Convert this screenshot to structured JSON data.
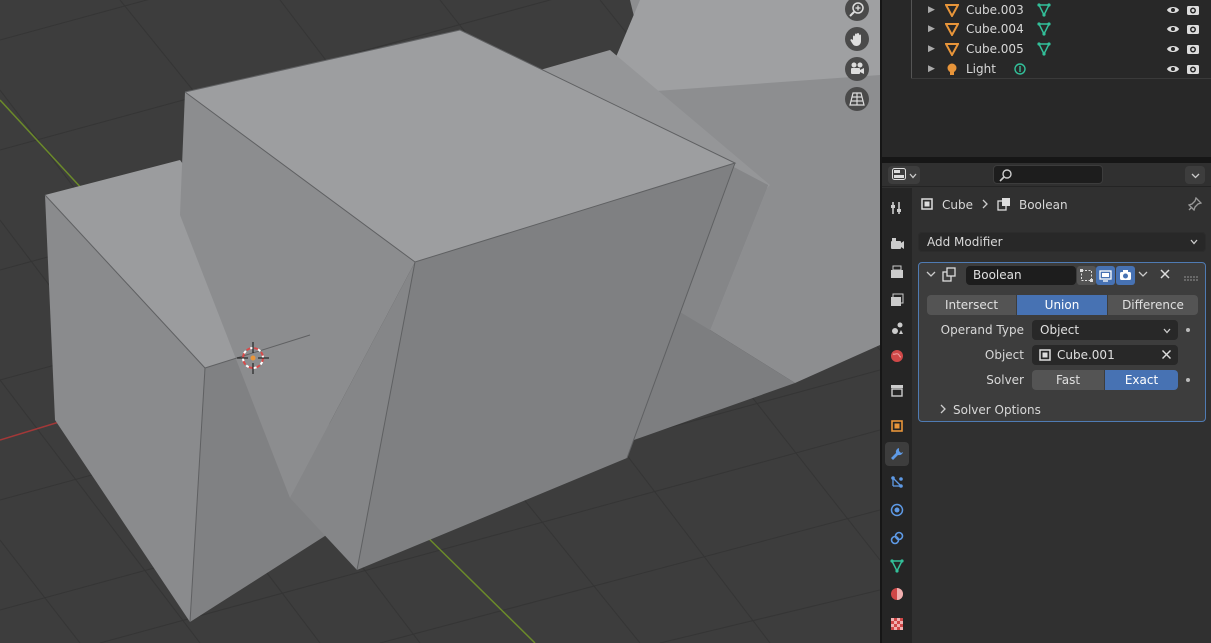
{
  "outliner": {
    "rows": [
      {
        "name": "Cube.003",
        "kind": "mesh"
      },
      {
        "name": "Cube.004",
        "kind": "mesh"
      },
      {
        "name": "Cube.005",
        "kind": "mesh"
      },
      {
        "name": "Light",
        "kind": "light"
      }
    ]
  },
  "viewport": {
    "nav_tools": [
      "zoom-icon",
      "hand-pan-icon",
      "camera-view-icon",
      "ortho-grid-icon"
    ]
  },
  "properties": {
    "search_placeholder": "",
    "breadcrumb": {
      "object": "Cube",
      "modifier": "Boolean"
    },
    "add_modifier": "Add Modifier",
    "modifier": {
      "name": "Boolean",
      "operations": [
        "Intersect",
        "Union",
        "Difference"
      ],
      "active_operation": "Union",
      "operand_type_label": "Operand Type",
      "operand_type_value": "Object",
      "object_label": "Object",
      "object_value": "Cube.001",
      "solver_label": "Solver",
      "solvers": [
        "Fast",
        "Exact"
      ],
      "active_solver": "Exact",
      "solver_options": "Solver Options"
    },
    "tabs": [
      "tool",
      "render",
      "output",
      "view-layer",
      "scene",
      "world",
      "collection",
      "object",
      "modifiers",
      "particles",
      "physics",
      "constraints",
      "data",
      "material",
      "texture"
    ],
    "active_tab": "modifiers"
  },
  "colors": {
    "accent": "#4772b3",
    "mesh_icon": "#e8953a",
    "data_green": "#33c09a",
    "viewport_bg": "#3d3d3d"
  }
}
